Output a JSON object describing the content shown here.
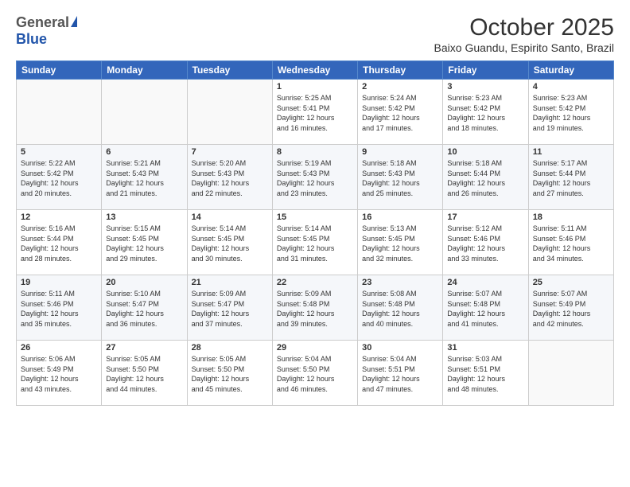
{
  "logo": {
    "general": "General",
    "blue": "Blue"
  },
  "header": {
    "month": "October 2025",
    "location": "Baixo Guandu, Espirito Santo, Brazil"
  },
  "weekdays": [
    "Sunday",
    "Monday",
    "Tuesday",
    "Wednesday",
    "Thursday",
    "Friday",
    "Saturday"
  ],
  "weeks": [
    [
      {
        "day": "",
        "info": ""
      },
      {
        "day": "",
        "info": ""
      },
      {
        "day": "",
        "info": ""
      },
      {
        "day": "1",
        "info": "Sunrise: 5:25 AM\nSunset: 5:41 PM\nDaylight: 12 hours\nand 16 minutes."
      },
      {
        "day": "2",
        "info": "Sunrise: 5:24 AM\nSunset: 5:42 PM\nDaylight: 12 hours\nand 17 minutes."
      },
      {
        "day": "3",
        "info": "Sunrise: 5:23 AM\nSunset: 5:42 PM\nDaylight: 12 hours\nand 18 minutes."
      },
      {
        "day": "4",
        "info": "Sunrise: 5:23 AM\nSunset: 5:42 PM\nDaylight: 12 hours\nand 19 minutes."
      }
    ],
    [
      {
        "day": "5",
        "info": "Sunrise: 5:22 AM\nSunset: 5:42 PM\nDaylight: 12 hours\nand 20 minutes."
      },
      {
        "day": "6",
        "info": "Sunrise: 5:21 AM\nSunset: 5:43 PM\nDaylight: 12 hours\nand 21 minutes."
      },
      {
        "day": "7",
        "info": "Sunrise: 5:20 AM\nSunset: 5:43 PM\nDaylight: 12 hours\nand 22 minutes."
      },
      {
        "day": "8",
        "info": "Sunrise: 5:19 AM\nSunset: 5:43 PM\nDaylight: 12 hours\nand 23 minutes."
      },
      {
        "day": "9",
        "info": "Sunrise: 5:18 AM\nSunset: 5:43 PM\nDaylight: 12 hours\nand 25 minutes."
      },
      {
        "day": "10",
        "info": "Sunrise: 5:18 AM\nSunset: 5:44 PM\nDaylight: 12 hours\nand 26 minutes."
      },
      {
        "day": "11",
        "info": "Sunrise: 5:17 AM\nSunset: 5:44 PM\nDaylight: 12 hours\nand 27 minutes."
      }
    ],
    [
      {
        "day": "12",
        "info": "Sunrise: 5:16 AM\nSunset: 5:44 PM\nDaylight: 12 hours\nand 28 minutes."
      },
      {
        "day": "13",
        "info": "Sunrise: 5:15 AM\nSunset: 5:45 PM\nDaylight: 12 hours\nand 29 minutes."
      },
      {
        "day": "14",
        "info": "Sunrise: 5:14 AM\nSunset: 5:45 PM\nDaylight: 12 hours\nand 30 minutes."
      },
      {
        "day": "15",
        "info": "Sunrise: 5:14 AM\nSunset: 5:45 PM\nDaylight: 12 hours\nand 31 minutes."
      },
      {
        "day": "16",
        "info": "Sunrise: 5:13 AM\nSunset: 5:45 PM\nDaylight: 12 hours\nand 32 minutes."
      },
      {
        "day": "17",
        "info": "Sunrise: 5:12 AM\nSunset: 5:46 PM\nDaylight: 12 hours\nand 33 minutes."
      },
      {
        "day": "18",
        "info": "Sunrise: 5:11 AM\nSunset: 5:46 PM\nDaylight: 12 hours\nand 34 minutes."
      }
    ],
    [
      {
        "day": "19",
        "info": "Sunrise: 5:11 AM\nSunset: 5:46 PM\nDaylight: 12 hours\nand 35 minutes."
      },
      {
        "day": "20",
        "info": "Sunrise: 5:10 AM\nSunset: 5:47 PM\nDaylight: 12 hours\nand 36 minutes."
      },
      {
        "day": "21",
        "info": "Sunrise: 5:09 AM\nSunset: 5:47 PM\nDaylight: 12 hours\nand 37 minutes."
      },
      {
        "day": "22",
        "info": "Sunrise: 5:09 AM\nSunset: 5:48 PM\nDaylight: 12 hours\nand 39 minutes."
      },
      {
        "day": "23",
        "info": "Sunrise: 5:08 AM\nSunset: 5:48 PM\nDaylight: 12 hours\nand 40 minutes."
      },
      {
        "day": "24",
        "info": "Sunrise: 5:07 AM\nSunset: 5:48 PM\nDaylight: 12 hours\nand 41 minutes."
      },
      {
        "day": "25",
        "info": "Sunrise: 5:07 AM\nSunset: 5:49 PM\nDaylight: 12 hours\nand 42 minutes."
      }
    ],
    [
      {
        "day": "26",
        "info": "Sunrise: 5:06 AM\nSunset: 5:49 PM\nDaylight: 12 hours\nand 43 minutes."
      },
      {
        "day": "27",
        "info": "Sunrise: 5:05 AM\nSunset: 5:50 PM\nDaylight: 12 hours\nand 44 minutes."
      },
      {
        "day": "28",
        "info": "Sunrise: 5:05 AM\nSunset: 5:50 PM\nDaylight: 12 hours\nand 45 minutes."
      },
      {
        "day": "29",
        "info": "Sunrise: 5:04 AM\nSunset: 5:50 PM\nDaylight: 12 hours\nand 46 minutes."
      },
      {
        "day": "30",
        "info": "Sunrise: 5:04 AM\nSunset: 5:51 PM\nDaylight: 12 hours\nand 47 minutes."
      },
      {
        "day": "31",
        "info": "Sunrise: 5:03 AM\nSunset: 5:51 PM\nDaylight: 12 hours\nand 48 minutes."
      },
      {
        "day": "",
        "info": ""
      }
    ]
  ]
}
